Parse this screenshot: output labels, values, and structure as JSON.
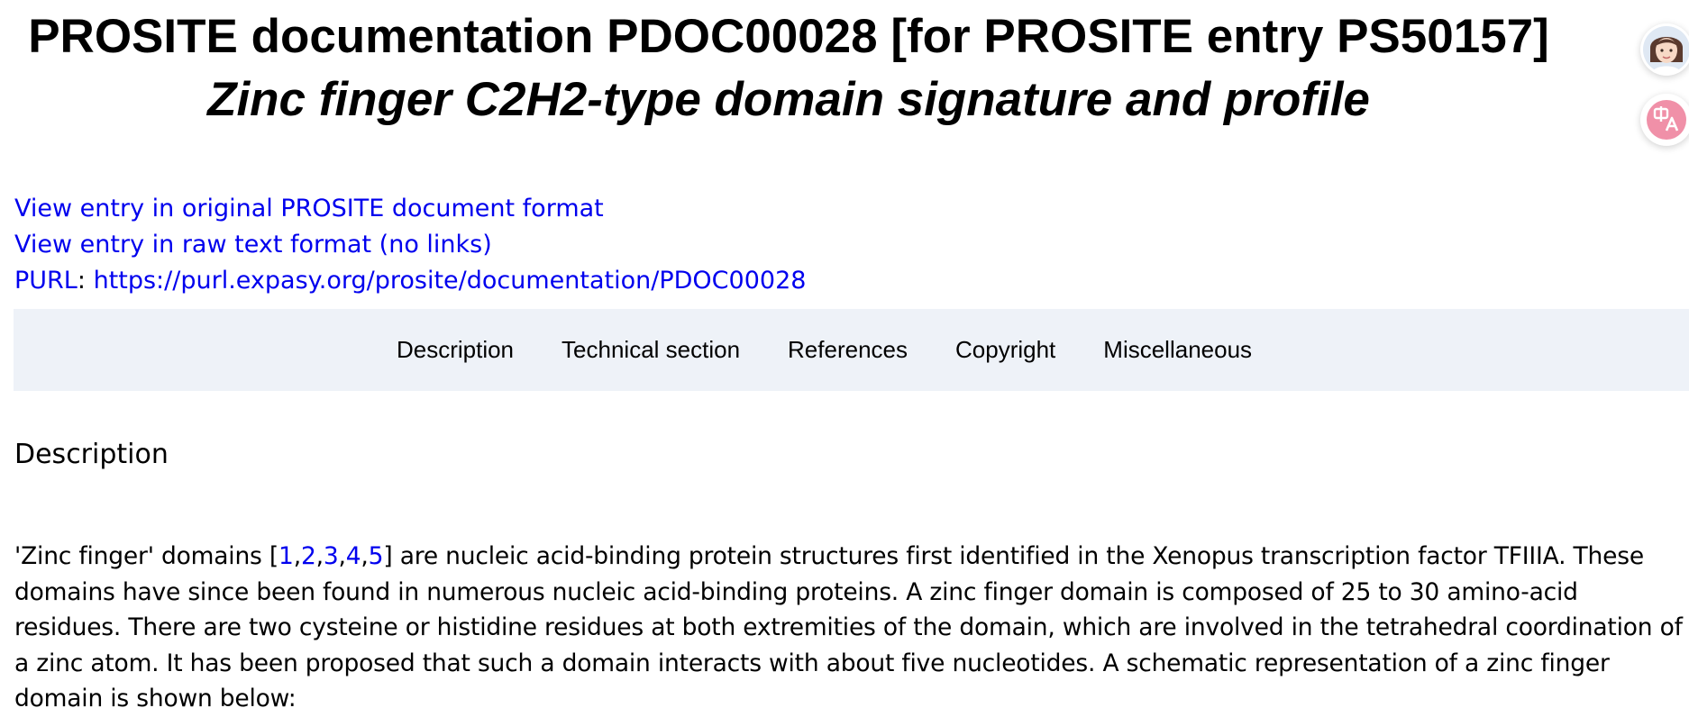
{
  "header": {
    "title": "PROSITE documentation PDOC00028 [for PROSITE entry PS50157]",
    "subtitle": "Zinc finger C2H2-type domain signature and profile"
  },
  "links": {
    "original_format": "View entry in original PROSITE document format",
    "raw_text": "View entry in raw text format (no links)",
    "purl_label": "PURL",
    "purl_sep": ":",
    "purl_url": "https://purl.expasy.org/prosite/documentation/PDOC00028"
  },
  "tabs": [
    {
      "label": "Description"
    },
    {
      "label": "Technical section"
    },
    {
      "label": "References"
    },
    {
      "label": "Copyright"
    },
    {
      "label": "Miscellaneous"
    }
  ],
  "section": {
    "title": "Description"
  },
  "paragraph": {
    "before_refs": "'Zinc finger' domains [",
    "refs": [
      "1",
      "2",
      "3",
      "4",
      "5"
    ],
    "ref_sep": ",",
    "after_refs": "] are nucleic acid-binding protein structures first identified in the Xenopus transcription factor TFIIIA. These domains have since been found in numerous nucleic acid-binding proteins. A zinc finger domain is composed of 25 to 30 amino-acid residues. There are two cysteine or histidine residues at both extremities of the domain, which are involved in the tetrahedral coordination of a zinc atom. It has been proposed that such a domain interacts with about five nucleotides. A schematic representation of a zinc finger domain is shown below:"
  },
  "side_buttons": {
    "avatar_icon": "assistant-avatar-icon",
    "translate_icon": "translate-icon",
    "translate_color": "#f090a8"
  }
}
